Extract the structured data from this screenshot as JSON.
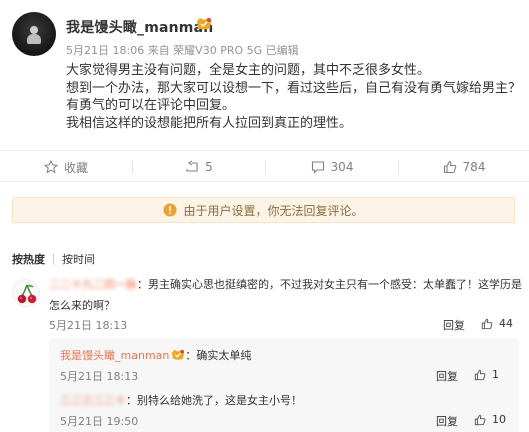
{
  "post": {
    "username": "我是馒头瞰_manman",
    "meta": "5月21日 18:06 来自 荣耀V30 PRO 5G   已编辑",
    "lines": [
      "大家觉得男主没有问题，全是女主的问题，其中不乏很多女性。",
      "想到一个办法，那大家可以设想一下，看过这些后，自己有没有勇气嫁给男主？",
      "有勇气的可以在评论中回复。",
      "我相信这样的设想能把所有人拉回到真正的理性。"
    ]
  },
  "actions": {
    "favorite": "收藏",
    "repost": "5",
    "comment": "304",
    "like": "784"
  },
  "notice": "由于用户设置，你无法回复评论。",
  "sort": {
    "hot": "按热度",
    "time": "按时间"
  },
  "comments": [
    {
      "name_blurred": "二二十九二四一脉",
      "text_line1": "：男主确实心思也挺缜密的，不过我对女主只有一个感受：太单蠢了！这学历是",
      "text_line2": "怎么来的啊？",
      "time": "5月21日 18:13",
      "reply": "回复",
      "likes": "44"
    }
  ],
  "replies": [
    {
      "name": "我是馒头瞰_manman",
      "text": "：确实太单纯",
      "time": "5月21日 18:13",
      "reply": "回复",
      "likes": "1"
    },
    {
      "name_blurred": "二二三二二十",
      "text": "：别特么给她洗了，这是女主小号！",
      "time": "5月21日 19:50",
      "reply": "回复",
      "likes": "10"
    }
  ],
  "colors": {
    "accent": "#eb7350",
    "notice_bg": "#fdf4e7",
    "muted": "#808080"
  }
}
